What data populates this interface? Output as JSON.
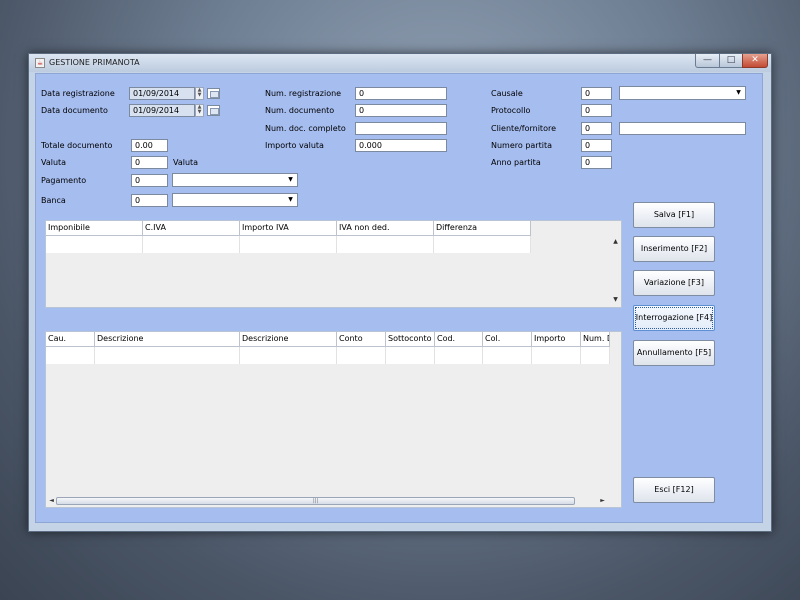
{
  "window": {
    "title": "GESTIONE PRIMANOTA"
  },
  "caption_buttons": {
    "minimize": "—",
    "maximize": "□",
    "close": "✕"
  },
  "form": {
    "data_registrazione": {
      "label": "Data registrazione",
      "value": "01/09/2014"
    },
    "data_documento": {
      "label": "Data documento",
      "value": "01/09/2014"
    },
    "num_registrazione": {
      "label": "Num. registrazione",
      "value": "0"
    },
    "num_documento": {
      "label": "Num. documento",
      "value": "0"
    },
    "num_doc_completo": {
      "label": "Num. doc. completo",
      "value": ""
    },
    "importo_valuta": {
      "label": "Importo valuta",
      "value": "0.000"
    },
    "causale": {
      "label": "Causale",
      "value": "0",
      "selected": ""
    },
    "protocollo": {
      "label": "Protocollo",
      "value": "0"
    },
    "cliente_fornitore": {
      "label": "Cliente/fornitore",
      "value": "0",
      "name": ""
    },
    "numero_partita": {
      "label": "Numero partita",
      "value": "0"
    },
    "anno_partita": {
      "label": "Anno partita",
      "value": "0"
    },
    "totale_documento": {
      "label": "Totale documento",
      "value": "0.00"
    },
    "valuta": {
      "label": "Valuta",
      "value": "0",
      "desc": "Valuta"
    },
    "pagamento": {
      "label": "Pagamento",
      "value": "0",
      "selected": ""
    },
    "banca": {
      "label": "Banca",
      "value": "0",
      "selected": ""
    }
  },
  "iva_table": {
    "columns": [
      "Imponibile",
      "C.IVA",
      "Importo IVA",
      "IVA non ded.",
      "Differenza"
    ]
  },
  "movements_table": {
    "columns": [
      "Cau.",
      "Descrizione",
      "Descrizione",
      "Conto",
      "Sottoconto",
      "Cod.",
      "Col.",
      "Importo",
      "Num. D"
    ]
  },
  "scroll": {
    "up": "▲",
    "down": "▼",
    "left": "◄",
    "right": "►",
    "grip": "|||"
  },
  "buttons": {
    "salva": "Salva [F1]",
    "inserimento": "Inserimento [F2]",
    "variazione": "Variazione [F3]",
    "interrogazione": "Interrogazione [F4]",
    "annullamento": "Annullamento [F5]",
    "esci": "Esci [F12]"
  },
  "icons": {
    "app": "java-cup-icon",
    "calendar": "calendar-icon",
    "dropdown": "chevron-down-icon"
  }
}
